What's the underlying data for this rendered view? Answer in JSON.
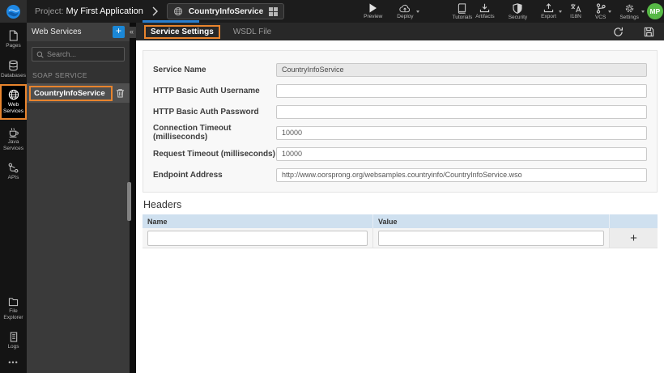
{
  "topbar": {
    "project_label": "Project:",
    "project_name": "My First Application",
    "service_tab": "CountryInfoService",
    "preview": "Preview",
    "deploy": "Deploy",
    "tutorials": "Tutorials",
    "artifacts": "Artifacts",
    "security": "Security",
    "export": "Export",
    "i18n": "I18N",
    "vcs": "VCS",
    "settings": "Settings",
    "avatar_initials": "MP"
  },
  "rail": {
    "pages": "Pages",
    "databases": "Databases",
    "web_services": "Web Services",
    "java_services": "Java Services",
    "apis": "APIs",
    "file_explorer": "File Explorer",
    "logs": "Logs",
    "more": "•••"
  },
  "panel": {
    "title": "Web Services",
    "add_label": "+",
    "search_placeholder": "Search...",
    "section": "SOAP SERVICE",
    "service_name": "CountryInfoService",
    "collapse_glyph": "«"
  },
  "main": {
    "tabs": [
      {
        "label": "Service Settings",
        "active": true
      },
      {
        "label": "WSDL File",
        "active": false
      }
    ],
    "form": {
      "fields": [
        {
          "label": "Service Name",
          "value": "CountryInfoService",
          "disabled": true
        },
        {
          "label": "HTTP Basic Auth Username",
          "value": ""
        },
        {
          "label": "HTTP Basic Auth Password",
          "value": ""
        },
        {
          "label": "Connection Timeout (milliseconds)",
          "value": "10000"
        },
        {
          "label": "Request Timeout (milliseconds)",
          "value": "10000"
        },
        {
          "label": "Endpoint Address",
          "value": "http://www.oorsprong.org/websamples.countryinfo/CountryInfoService.wso"
        }
      ]
    },
    "headers_section": {
      "title": "Headers",
      "columns": [
        "Name",
        "Value"
      ],
      "add_label": "+"
    }
  },
  "colors": {
    "annotation_orange": "#e8842d",
    "accent_blue": "#1b87d6",
    "tab_underline_blue": "#2a7fd0",
    "avatar_green": "#57b846",
    "table_header_blue": "#cfe0ef"
  }
}
